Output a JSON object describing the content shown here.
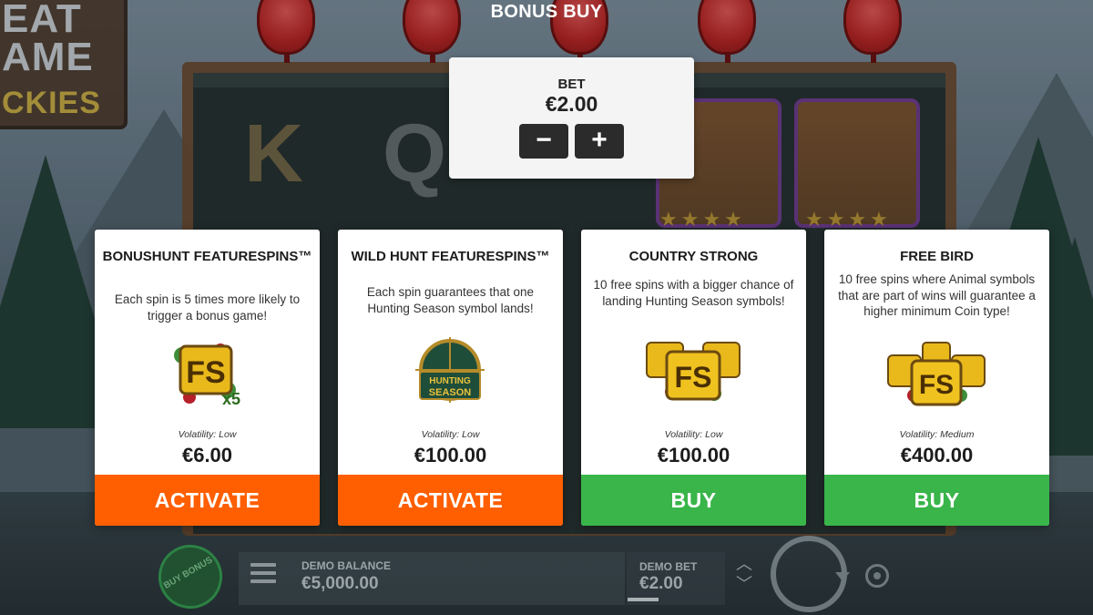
{
  "header": {
    "title": "BONUS BUY"
  },
  "background": {
    "logo_lines": [
      "EAT",
      "AME",
      "CKIES"
    ]
  },
  "bet_panel": {
    "label": "BET",
    "value": "€2.00",
    "minus": "−",
    "plus": "+"
  },
  "cards": [
    {
      "title": "BONUSHUNT FEATURESPINS™",
      "description": "Each spin is 5 times more likely to trigger a bonus game!",
      "icon": "fs-x5-icon",
      "icon_text": "FS",
      "icon_badge": "x5",
      "volatility": "Volatility: Low",
      "price": "€6.00",
      "button": "ACTIVATE",
      "button_color": "#ff5f00"
    },
    {
      "title": "WILD HUNT FEATURESPINS™",
      "description": "Each spin guarantees that one Hunting Season symbol lands!",
      "icon": "hunting-season-icon",
      "icon_text": "HUNTING SEASON",
      "volatility": "Volatility: Low",
      "price": "€100.00",
      "button": "ACTIVATE",
      "button_color": "#ff5f00"
    },
    {
      "title": "COUNTRY STRONG",
      "description": "10 free spins with a bigger chance of landing Hunting Season symbols!",
      "icon": "fs-stack-icon",
      "icon_text": "FS",
      "volatility": "Volatility: Low",
      "price": "€100.00",
      "button": "BUY",
      "button_color": "#39b54a"
    },
    {
      "title": "FREE BIRD",
      "description": "10 free spins where Animal symbols that are part of wins will guarantee a higher minimum Coin type!",
      "icon": "fs-stack-icon",
      "icon_text": "FS",
      "volatility": "Volatility: Medium",
      "price": "€400.00",
      "button": "BUY",
      "button_color": "#39b54a"
    }
  ],
  "bottom_bar": {
    "buy_bonus": "BUY BONUS",
    "balance_label": "DEMO BALANCE",
    "balance_value": "€5,000.00",
    "bet_label": "DEMO BET",
    "bet_value": "€2.00"
  }
}
